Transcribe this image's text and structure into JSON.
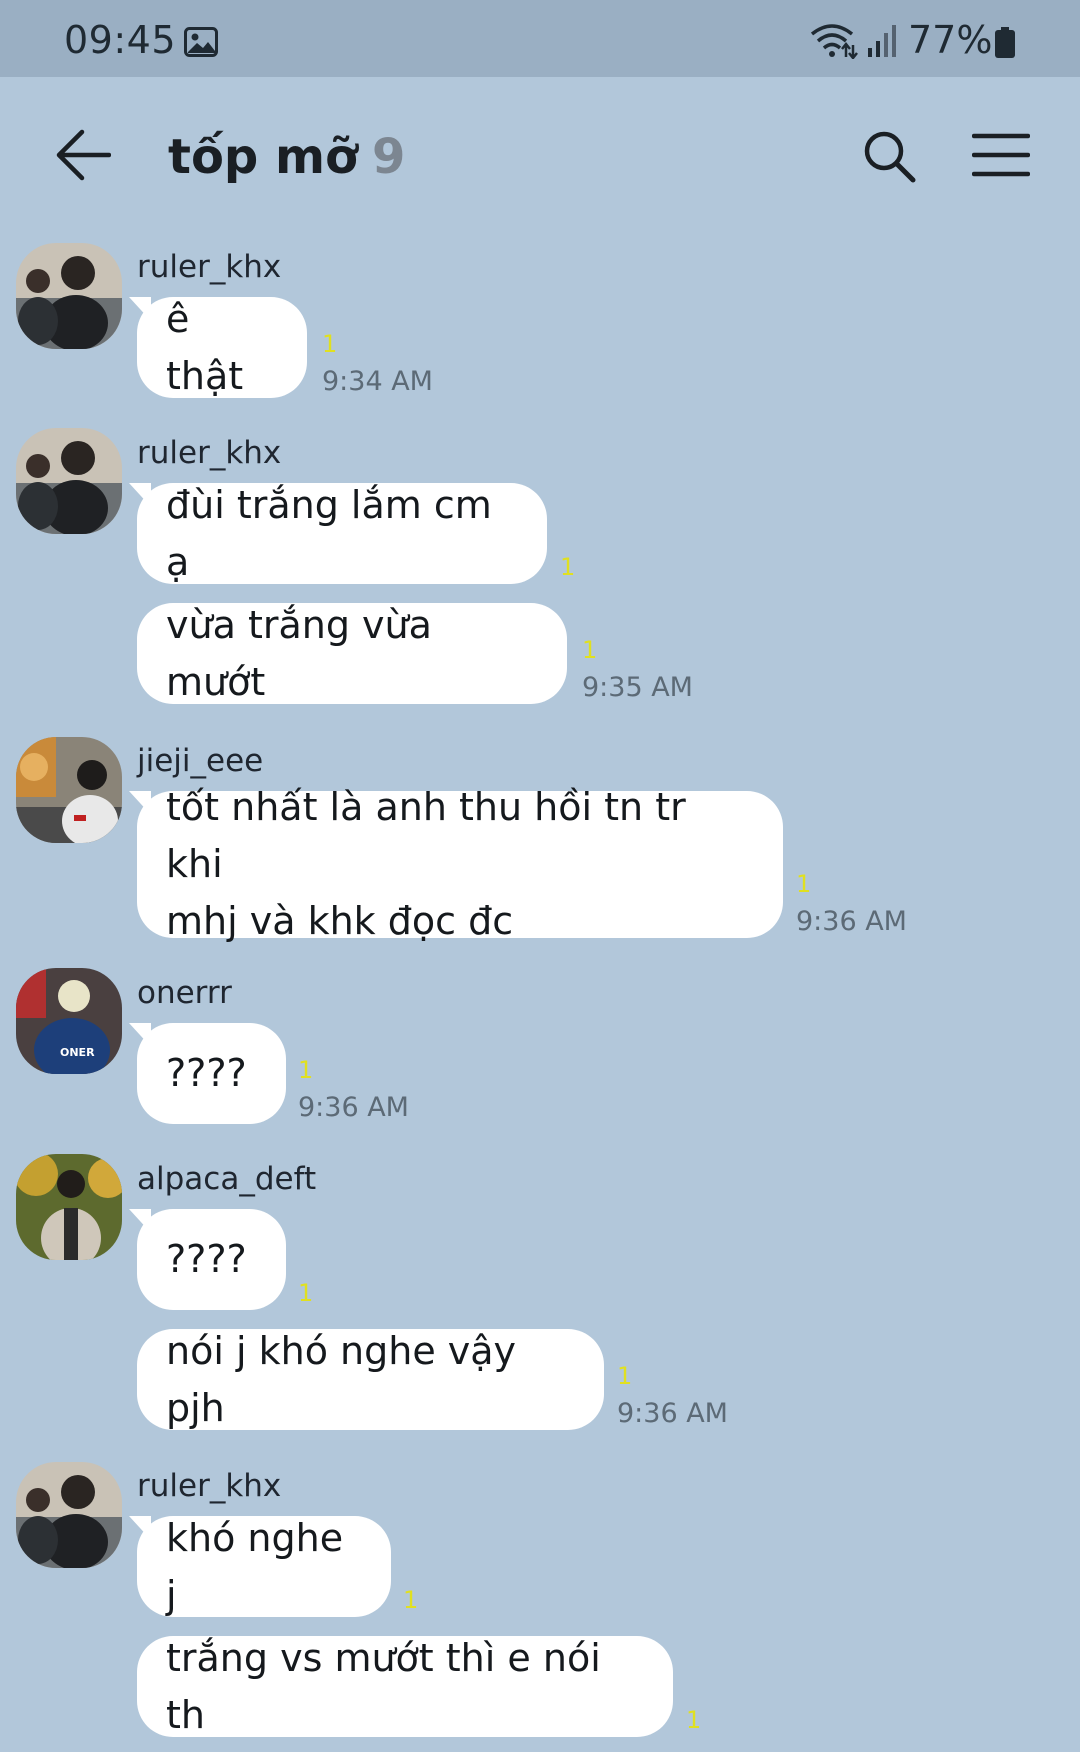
{
  "status_bar": {
    "time": "09:45",
    "battery": "77%",
    "icons": [
      "image-icon",
      "wifi-icon",
      "signal-icon",
      "battery-icon"
    ]
  },
  "header": {
    "title": "tốp mỡ",
    "member_count": "9",
    "icons": [
      "back-arrow-icon",
      "search-icon",
      "menu-icon"
    ]
  },
  "messages": [
    {
      "sender": "ruler_khx",
      "bubbles": [
        {
          "text": "ê thật",
          "unread": "1",
          "time": "9:34 AM"
        }
      ]
    },
    {
      "sender": "ruler_khx",
      "bubbles": [
        {
          "text": "đùi trắng lắm cm ạ",
          "unread": "1",
          "time": ""
        },
        {
          "text": "vừa trắng vừa mướt",
          "unread": "1",
          "time": "9:35 AM"
        }
      ]
    },
    {
      "sender": "jieji_eee",
      "bubbles": [
        {
          "text": "tốt nhất là anh thu hồi tn tr khi\nmhj và khk đọc đc",
          "unread": "1",
          "time": "9:36 AM"
        }
      ]
    },
    {
      "sender": "onerrr",
      "bubbles": [
        {
          "text": "????",
          "unread": "1",
          "time": "9:36 AM"
        }
      ]
    },
    {
      "sender": "alpaca_deft",
      "bubbles": [
        {
          "text": "????",
          "unread": "1",
          "time": ""
        },
        {
          "text": "nói j khó nghe vậy pjh",
          "unread": "1",
          "time": "9:36 AM"
        }
      ]
    },
    {
      "sender": "ruler_khx",
      "bubbles": [
        {
          "text": "khó nghe j",
          "unread": "1",
          "time": ""
        },
        {
          "text": "trắng vs mướt thì e nói th",
          "unread": "1",
          "time": ""
        }
      ]
    }
  ],
  "avatar_jersey_text": "ONER"
}
